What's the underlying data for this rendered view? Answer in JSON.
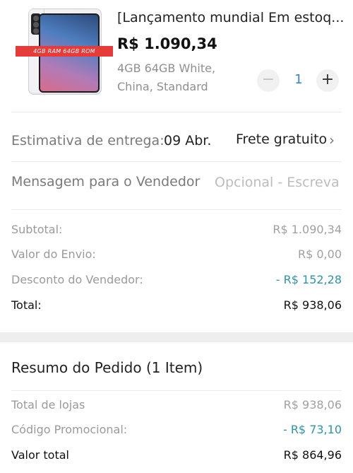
{
  "product": {
    "image_badge": "4GB RAM 64GB ROM",
    "title": "[Lançamento mundial Em estoq...",
    "price": "R$ 1.090,34",
    "variant_line1": "4GB 64GB White,",
    "variant_line2": "China, Standard",
    "quantity": "1",
    "minus_symbol": "−",
    "plus_symbol": "+"
  },
  "delivery": {
    "label": "Estimativa de entrega:",
    "date": "09 Abr.",
    "shipping": "Frete gratuito",
    "chevron": "›"
  },
  "message": {
    "label": "Mensagem para o Vendedor",
    "placeholder": "Opcional - Escreva"
  },
  "costs": [
    {
      "label": "Subtotal:",
      "value": "R$ 1.090,34"
    },
    {
      "label": "Valor do Envio:",
      "value": "R$ 0,00"
    },
    {
      "label": "Desconto do Vendedor:",
      "value": "- R$ 152,28"
    },
    {
      "label": "Total:",
      "value": "R$ 938,06"
    }
  ],
  "summary": {
    "title": "Resumo do Pedido (1 Item)",
    "rows": [
      {
        "label": "Total de lojas",
        "value": "R$ 938,06"
      },
      {
        "label": "Código Promocional:",
        "value": "- R$ 73,10"
      },
      {
        "label": "Valor total",
        "value": "R$ 864,96"
      }
    ]
  },
  "colors": {
    "accent_blue": "#3b82c4",
    "discount_teal": "#2f93a8",
    "badge_red": "#e53b3b"
  }
}
